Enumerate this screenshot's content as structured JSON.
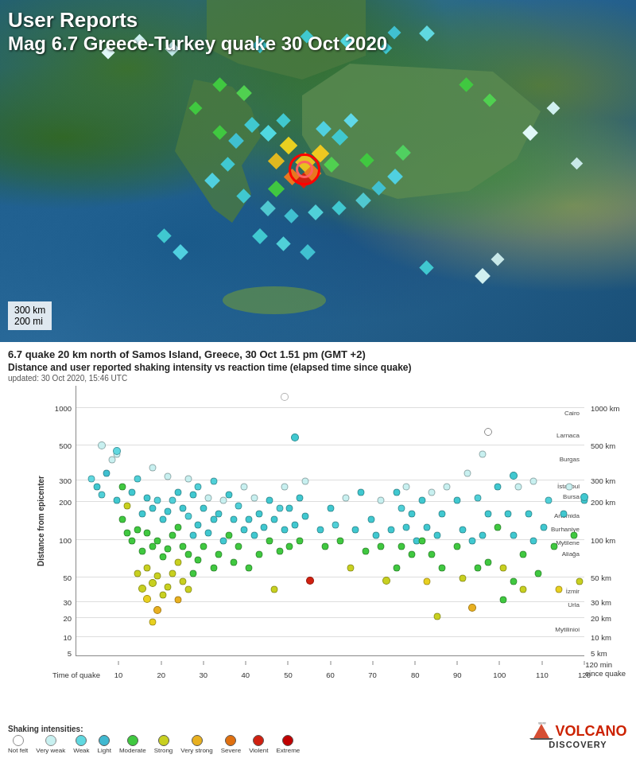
{
  "map": {
    "title_line1": "User Reports",
    "title_line2": "Mag 6.7 Greece-Turkey quake 30 Oct 2020",
    "scale_km": "300 km",
    "scale_mi": "200 mi"
  },
  "chart": {
    "title1": "6.7 quake 20 km north of Samos Island, Greece, 30 Oct 1.51 pm (GMT +2)",
    "title2": "Distance and user reported shaking intensity vs reaction time (elapsed time since quake)",
    "updated": "updated: 30 Oct 2020, 15:46 UTC",
    "x_axis_title": "120 min since quake",
    "y_axis_title": "Distance from epicenter",
    "x_labels": [
      "Time of quake",
      "10",
      "20",
      "30",
      "40",
      "50",
      "60",
      "70",
      "80",
      "90",
      "100",
      "110",
      "120"
    ],
    "y_labels_km": [
      "1000",
      "500",
      "300",
      "200",
      "100",
      "50",
      "30",
      "20",
      "10",
      "5"
    ],
    "y_labels_km_right": [
      "1000 km",
      "500 km",
      "300 km",
      "200 km",
      "100 km",
      "50 km",
      "30 km",
      "20 km",
      "10 km",
      "5 km"
    ],
    "cities": [
      {
        "name": "Cairo",
        "y_pct": 2
      },
      {
        "name": "Larnaca",
        "y_pct": 7
      },
      {
        "name": "Burgas",
        "y_pct": 12
      },
      {
        "name": "Istanbul",
        "y_pct": 18
      },
      {
        "name": "Bursa",
        "y_pct": 22
      },
      {
        "name": "Artemida",
        "y_pct": 26
      },
      {
        "name": "Burhaniye",
        "y_pct": 31
      },
      {
        "name": "Mytilene",
        "y_pct": 35
      },
      {
        "name": "Aliağa",
        "y_pct": 40
      },
      {
        "name": "İzmir",
        "y_pct": 55
      },
      {
        "name": "Urla",
        "y_pct": 60
      },
      {
        "name": "Mytilinioi",
        "y_pct": 80
      }
    ]
  },
  "legend": {
    "title": "Shaking intensities:",
    "items": [
      {
        "label": "Not felt",
        "color": "#ffffff",
        "border": "#888"
      },
      {
        "label": "Very weak",
        "color": "#c8f0f0",
        "border": "#888"
      },
      {
        "label": "Weak",
        "color": "#60d0e0",
        "border": "#888"
      },
      {
        "label": "Light",
        "color": "#40b8d0",
        "border": "#888"
      },
      {
        "label": "Moderate",
        "color": "#40c840",
        "border": "#888"
      },
      {
        "label": "Strong",
        "color": "#c8d020",
        "border": "#888"
      },
      {
        "label": "Very strong",
        "color": "#e8b020",
        "border": "#888"
      },
      {
        "label": "Severe",
        "color": "#e07010",
        "border": "#888"
      },
      {
        "label": "Violent",
        "color": "#d02010",
        "border": "#888"
      },
      {
        "label": "Extreme",
        "color": "#c00000",
        "border": "#888"
      }
    ]
  },
  "logo": {
    "volcano": "VOLCANO",
    "discovery": "DISCOVERY"
  }
}
